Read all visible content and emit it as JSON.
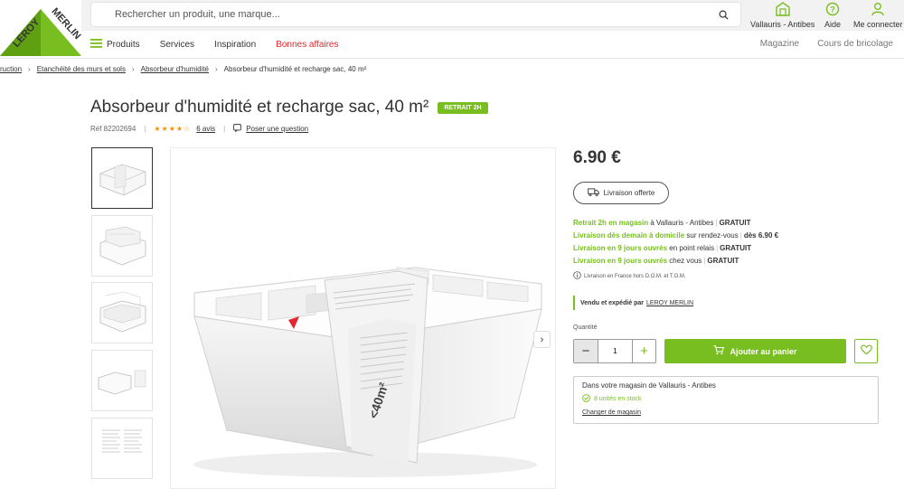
{
  "brand": {
    "name": "LEROY MERLIN",
    "color": "#78be20"
  },
  "search": {
    "placeholder": "Rechercher un produit, une marque..."
  },
  "header_actions": [
    {
      "label": "Vallauris - Antibes",
      "icon": "store-icon"
    },
    {
      "label": "Aide",
      "icon": "help-icon"
    },
    {
      "label": "Me connecter",
      "icon": "user-icon"
    }
  ],
  "nav": {
    "products": "Produits",
    "services": "Services",
    "inspiration": "Inspiration",
    "deals": "Bonnes affaires",
    "magazine": "Magazine",
    "courses": "Cours de bricolage"
  },
  "breadcrumb": [
    "ruction",
    "Etanchéité des murs et sols",
    "Absorbeur d'humidité",
    "Absorbeur d'humidité et recharge sac, 40 m²"
  ],
  "product": {
    "title": "Absorbeur d'humidité et recharge sac, 40 m²",
    "badge": "RETRAIT 2H",
    "ref": "Réf 82202694",
    "rating_stars": "★★★★☆",
    "rating": 4,
    "reviews": "6 avis",
    "ask_question": "Poser une question",
    "price": "6.90 €",
    "delivery_pill": "Livraison offerte",
    "pack_label": "<40m²"
  },
  "shipping": [
    {
      "green": "Retrait 2h en magasin",
      "rest": " à Vallauris - Antibes",
      "bold": "GRATUIT"
    },
    {
      "green": "Livraison dès demain à domicile",
      "rest": " sur rendez-vous",
      "bold": "dès 6.90 €"
    },
    {
      "green": "Livraison en 9 jours ouvrés",
      "rest": " en point relais",
      "bold": "GRATUIT"
    },
    {
      "green": "Livraison en 9 jours ouvrés",
      "rest": " chez vous",
      "bold": "GRATUIT"
    }
  ],
  "shipping_info": "Livraison en France hors D.O.M. et T.O.M.",
  "seller": {
    "prefix": "Vendu et expédié par",
    "name": "LEROY MERLIN"
  },
  "quantity": {
    "label": "Quantité",
    "value": "1"
  },
  "add_to_cart": "Ajouter au panier",
  "store": {
    "title": "Dans votre magasin de Vallauris - Antibes",
    "stock": "8 unités en stock",
    "change": "Changer de magasin"
  }
}
